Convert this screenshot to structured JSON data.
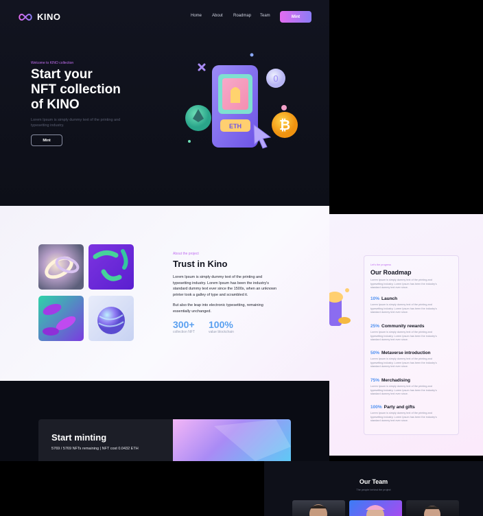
{
  "brand": {
    "name": "KINO"
  },
  "nav": {
    "items": [
      "Home",
      "About",
      "Roadmap",
      "Team"
    ],
    "cta": "Mint"
  },
  "hero": {
    "kicker": "Welcome to KINO collection",
    "title_line1": "Start your",
    "title_line2": "NFT collection",
    "title_line3": "of KINO",
    "desc_line1": "Lorem Ipsum is simply dummy text of the printing and",
    "desc_line2": "typesetting industry.",
    "button": "Mint",
    "illustration": {
      "price_tag": "ETH",
      "icons": [
        "ethereum-coin-icon",
        "bitcoin-coin-icon",
        "token-coin-icon",
        "cursor-icon",
        "close-icon"
      ]
    }
  },
  "about": {
    "kicker": "About the project",
    "title": "Trust in Kino",
    "p1": [
      "Lorem Ipsum is simply dummy text of the printing and",
      "typesetting industry. Lorem Ipsum has been the industry's",
      "standard dummy text ever since the 1500s, when an unknown",
      "printer took a galley of type and scrambled it."
    ],
    "p2": [
      "But also the leap into electronic typesetting, remaining",
      "essentially unchanged."
    ],
    "stats": [
      {
        "value": "300+",
        "label": "collection NFT"
      },
      {
        "value": "100%",
        "label": "value blockchain"
      }
    ]
  },
  "roadmap": {
    "kicker": "Let's the progress",
    "title": "Our Roadmap",
    "intro": [
      "Lorem Ipsum is simply dummy text of the printing and",
      "typesetting industry. Lorem Ipsum has been the industry's",
      "standard dummy text ever since."
    ],
    "items": [
      {
        "pct": "10%",
        "title": "Launch"
      },
      {
        "pct": "25%",
        "title": "Community rewards"
      },
      {
        "pct": "50%",
        "title": "Metaverse introduction"
      },
      {
        "pct": "75%",
        "title": "Merchadising"
      },
      {
        "pct": "100%",
        "title": "Party and gifts"
      }
    ],
    "item_desc": [
      "Lorem Ipsum is simply dummy text of the printing and",
      "typesetting industry. Lorem Ipsum has been the industry's",
      "standard dummy text ever since."
    ]
  },
  "minting": {
    "title": "Start minting",
    "subtitle": "5769 / 5769 NFTs remaining | NFT cost 0.0432 ETH"
  },
  "team": {
    "title": "Our Team",
    "subtitle": "The people behind the project"
  },
  "colors": {
    "accent_pink": "#e36cf0",
    "accent_purple": "#8c7cf6",
    "stat_blue": "#5aa0f0",
    "dark_bg": "#0d0f18"
  }
}
